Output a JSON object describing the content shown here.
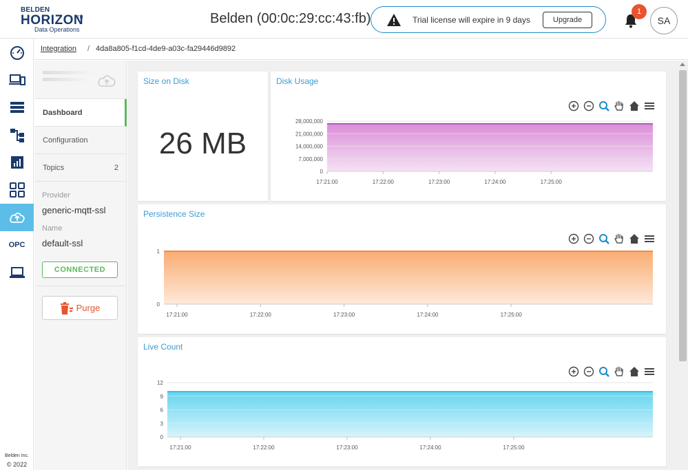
{
  "header": {
    "logo_top": "BELDEN",
    "logo_main": "HORIZON",
    "logo_tm": "TM",
    "logo_sub": "Data Operations",
    "device_title": "Belden (00:0c:29:cc:43:fb)",
    "trial_message": "Trial license will expire in 9 days",
    "upgrade_label": "Upgrade",
    "notification_count": "1",
    "avatar_initials": "SA"
  },
  "rail": {
    "items": [
      "dashboard-gauge-icon",
      "devices-icon",
      "list-icon",
      "workflow-icon",
      "chart-icon",
      "apps-grid-icon",
      "cloud-upload-icon",
      "OPC",
      "laptop-icon"
    ],
    "active_index": 6,
    "opc_label": "OPC",
    "footer_company": "Belden Inc.",
    "footer_year": "© 2022"
  },
  "breadcrumb": {
    "link": "Integration",
    "separator": "/",
    "current": "4da8a805-f1cd-4de9-a03c-fa29446d9892"
  },
  "side": {
    "tabs": [
      {
        "label": "Dashboard",
        "active": true
      },
      {
        "label": "Configuration",
        "active": false
      },
      {
        "label": "Topics",
        "count": "2",
        "active": false
      }
    ],
    "provider_label": "Provider",
    "provider_value": "generic-mqtt-ssl",
    "name_label": "Name",
    "name_value": "default-ssl",
    "status": "CONNECTED",
    "purge_label": "Purge"
  },
  "cards": {
    "size_on_disk_title": "Size on Disk",
    "size_on_disk_value": "26 MB",
    "disk_usage_title": "Disk Usage",
    "persistence_title": "Persistence Size",
    "live_count_title": "Live Count"
  },
  "colors": {
    "accent": "#3a9bd5",
    "disk_usage_fill": "#d988d6",
    "persistence_fill": "#f9a86a",
    "live_count_fill": "#5dd3ee",
    "connected": "#5bb85b",
    "danger": "#e8542f"
  },
  "chart_data": [
    {
      "type": "area",
      "title": "Disk Usage",
      "x": [
        "17:21:00",
        "17:22:00",
        "17:23:00",
        "17:24:00",
        "17:25:00"
      ],
      "y_ticks": [
        "0",
        "7,000,000",
        "14,000,000",
        "21,000,000",
        "28,000,000"
      ],
      "ylim": [
        0,
        28000000
      ],
      "series": [
        {
          "values": [
            26500000,
            26500000,
            26500000,
            26500000,
            26500000
          ]
        }
      ],
      "grid": true
    },
    {
      "type": "area",
      "title": "Persistence Size",
      "x": [
        "17:21:00",
        "17:22:00",
        "17:23:00",
        "17:24:00",
        "17:25:00"
      ],
      "y_ticks": [
        "0",
        "1"
      ],
      "ylim": [
        0,
        1
      ],
      "series": [
        {
          "values": [
            1,
            1,
            1,
            1,
            1
          ]
        }
      ],
      "grid": true
    },
    {
      "type": "area",
      "title": "Live Count",
      "x": [
        "17:21:00",
        "17:22:00",
        "17:23:00",
        "17:24:00",
        "17:25:00"
      ],
      "y_ticks": [
        "0",
        "3",
        "6",
        "9",
        "12"
      ],
      "ylim": [
        0,
        12
      ],
      "series": [
        {
          "values": [
            10,
            10,
            10,
            10,
            10
          ]
        }
      ],
      "grid": true
    }
  ]
}
